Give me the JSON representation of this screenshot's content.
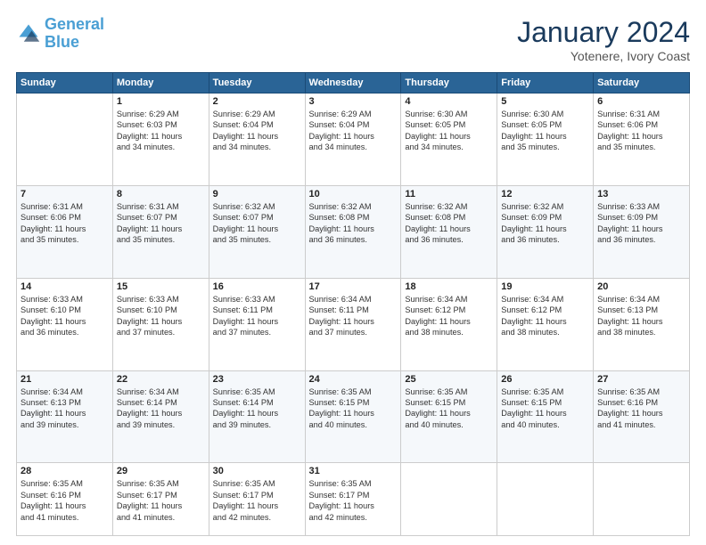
{
  "header": {
    "logo_line1": "General",
    "logo_line2": "Blue",
    "month": "January 2024",
    "location": "Yotenere, Ivory Coast"
  },
  "days_of_week": [
    "Sunday",
    "Monday",
    "Tuesday",
    "Wednesday",
    "Thursday",
    "Friday",
    "Saturday"
  ],
  "weeks": [
    [
      {
        "day": "",
        "info": ""
      },
      {
        "day": "1",
        "info": "Sunrise: 6:29 AM\nSunset: 6:03 PM\nDaylight: 11 hours\nand 34 minutes."
      },
      {
        "day": "2",
        "info": "Sunrise: 6:29 AM\nSunset: 6:04 PM\nDaylight: 11 hours\nand 34 minutes."
      },
      {
        "day": "3",
        "info": "Sunrise: 6:29 AM\nSunset: 6:04 PM\nDaylight: 11 hours\nand 34 minutes."
      },
      {
        "day": "4",
        "info": "Sunrise: 6:30 AM\nSunset: 6:05 PM\nDaylight: 11 hours\nand 34 minutes."
      },
      {
        "day": "5",
        "info": "Sunrise: 6:30 AM\nSunset: 6:05 PM\nDaylight: 11 hours\nand 35 minutes."
      },
      {
        "day": "6",
        "info": "Sunrise: 6:31 AM\nSunset: 6:06 PM\nDaylight: 11 hours\nand 35 minutes."
      }
    ],
    [
      {
        "day": "7",
        "info": "Sunrise: 6:31 AM\nSunset: 6:06 PM\nDaylight: 11 hours\nand 35 minutes."
      },
      {
        "day": "8",
        "info": "Sunrise: 6:31 AM\nSunset: 6:07 PM\nDaylight: 11 hours\nand 35 minutes."
      },
      {
        "day": "9",
        "info": "Sunrise: 6:32 AM\nSunset: 6:07 PM\nDaylight: 11 hours\nand 35 minutes."
      },
      {
        "day": "10",
        "info": "Sunrise: 6:32 AM\nSunset: 6:08 PM\nDaylight: 11 hours\nand 36 minutes."
      },
      {
        "day": "11",
        "info": "Sunrise: 6:32 AM\nSunset: 6:08 PM\nDaylight: 11 hours\nand 36 minutes."
      },
      {
        "day": "12",
        "info": "Sunrise: 6:32 AM\nSunset: 6:09 PM\nDaylight: 11 hours\nand 36 minutes."
      },
      {
        "day": "13",
        "info": "Sunrise: 6:33 AM\nSunset: 6:09 PM\nDaylight: 11 hours\nand 36 minutes."
      }
    ],
    [
      {
        "day": "14",
        "info": "Sunrise: 6:33 AM\nSunset: 6:10 PM\nDaylight: 11 hours\nand 36 minutes."
      },
      {
        "day": "15",
        "info": "Sunrise: 6:33 AM\nSunset: 6:10 PM\nDaylight: 11 hours\nand 37 minutes."
      },
      {
        "day": "16",
        "info": "Sunrise: 6:33 AM\nSunset: 6:11 PM\nDaylight: 11 hours\nand 37 minutes."
      },
      {
        "day": "17",
        "info": "Sunrise: 6:34 AM\nSunset: 6:11 PM\nDaylight: 11 hours\nand 37 minutes."
      },
      {
        "day": "18",
        "info": "Sunrise: 6:34 AM\nSunset: 6:12 PM\nDaylight: 11 hours\nand 38 minutes."
      },
      {
        "day": "19",
        "info": "Sunrise: 6:34 AM\nSunset: 6:12 PM\nDaylight: 11 hours\nand 38 minutes."
      },
      {
        "day": "20",
        "info": "Sunrise: 6:34 AM\nSunset: 6:13 PM\nDaylight: 11 hours\nand 38 minutes."
      }
    ],
    [
      {
        "day": "21",
        "info": "Sunrise: 6:34 AM\nSunset: 6:13 PM\nDaylight: 11 hours\nand 39 minutes."
      },
      {
        "day": "22",
        "info": "Sunrise: 6:34 AM\nSunset: 6:14 PM\nDaylight: 11 hours\nand 39 minutes."
      },
      {
        "day": "23",
        "info": "Sunrise: 6:35 AM\nSunset: 6:14 PM\nDaylight: 11 hours\nand 39 minutes."
      },
      {
        "day": "24",
        "info": "Sunrise: 6:35 AM\nSunset: 6:15 PM\nDaylight: 11 hours\nand 40 minutes."
      },
      {
        "day": "25",
        "info": "Sunrise: 6:35 AM\nSunset: 6:15 PM\nDaylight: 11 hours\nand 40 minutes."
      },
      {
        "day": "26",
        "info": "Sunrise: 6:35 AM\nSunset: 6:15 PM\nDaylight: 11 hours\nand 40 minutes."
      },
      {
        "day": "27",
        "info": "Sunrise: 6:35 AM\nSunset: 6:16 PM\nDaylight: 11 hours\nand 41 minutes."
      }
    ],
    [
      {
        "day": "28",
        "info": "Sunrise: 6:35 AM\nSunset: 6:16 PM\nDaylight: 11 hours\nand 41 minutes."
      },
      {
        "day": "29",
        "info": "Sunrise: 6:35 AM\nSunset: 6:17 PM\nDaylight: 11 hours\nand 41 minutes."
      },
      {
        "day": "30",
        "info": "Sunrise: 6:35 AM\nSunset: 6:17 PM\nDaylight: 11 hours\nand 42 minutes."
      },
      {
        "day": "31",
        "info": "Sunrise: 6:35 AM\nSunset: 6:17 PM\nDaylight: 11 hours\nand 42 minutes."
      },
      {
        "day": "",
        "info": ""
      },
      {
        "day": "",
        "info": ""
      },
      {
        "day": "",
        "info": ""
      }
    ]
  ]
}
